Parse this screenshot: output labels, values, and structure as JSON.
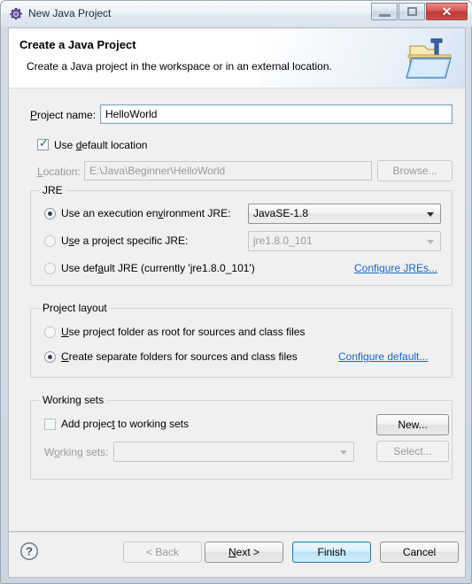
{
  "window": {
    "title": "New Java Project",
    "icon": "java-project-gear-icon",
    "controls": {
      "minimize": "minimize-button",
      "maximize": "maximize-button",
      "close_glyph": "✕"
    }
  },
  "banner": {
    "title": "Create a Java Project",
    "subtitle": "Create a Java project in the workspace or in an external location.",
    "icon": "java-folder-icon"
  },
  "form": {
    "project_name_label_pre": "P",
    "project_name_label_mnemonic": "r",
    "project_name_label": "Project name:",
    "project_name_value": "HelloWorld",
    "project_name_placeholder": "",
    "use_default_location_label": "Use default location",
    "use_default_location_checked": true,
    "location_label": "Location:",
    "location_value": "E:\\Java\\Beginner\\HelloWorld",
    "location_enabled": false,
    "browse_label": "Browse...",
    "browse_enabled": false
  },
  "jre": {
    "group_title": "JRE",
    "options": [
      {
        "label": "Use an execution environment JRE:",
        "selected": true,
        "control_type": "combobox",
        "control_value": "JavaSE-1.8",
        "control_enabled": true
      },
      {
        "label": "Use a project specific JRE:",
        "selected": false,
        "control_type": "combobox",
        "control_value": "jre1.8.0_101",
        "control_enabled": false
      },
      {
        "label": "Use default JRE (currently 'jre1.8.0_101')",
        "selected": false,
        "control_type": "none",
        "control_value": "",
        "control_enabled": false
      }
    ],
    "configure_link": "Configure JREs..."
  },
  "project_layout": {
    "group_title": "Project layout",
    "options": [
      {
        "label": "Use project folder as root for sources and class files",
        "selected": false
      },
      {
        "label": "Create separate folders for sources and class files",
        "selected": true
      }
    ],
    "configure_link": "Configure default..."
  },
  "working_sets": {
    "group_title": "Working sets",
    "add_checkbox_label": "Add project to working sets",
    "add_checkbox_checked": false,
    "new_button_label": "New...",
    "working_sets_label": "Working sets:",
    "working_sets_value": "",
    "select_button_label": "Select...",
    "select_button_enabled": false
  },
  "buttons": {
    "help": "help-icon",
    "back": "< Back",
    "back_enabled": false,
    "next": "Next >",
    "finish": "Finish",
    "cancel": "Cancel",
    "default_button": "Finish"
  },
  "colors": {
    "accent_link": "#1567c8",
    "default_button_border": "#2a7fba",
    "close_button": "#cf4b44",
    "content_bg": "#f0f0f0",
    "banner_bg": "#ffffff"
  }
}
